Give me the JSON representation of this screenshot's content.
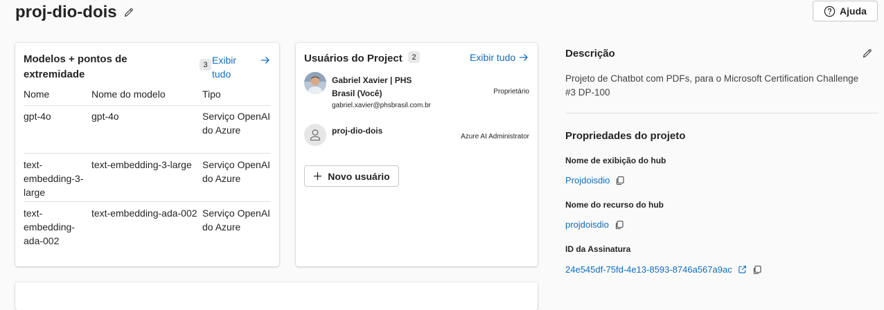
{
  "header": {
    "project_title": "proj-dio-dois",
    "help_label": "Ajuda"
  },
  "models_card": {
    "title_line1": "Modelos + pontos de",
    "title_line2": "extremidade",
    "count": "3",
    "view_all_line1": "Exibir",
    "view_all_line2": "tudo",
    "columns": [
      "Nome",
      "Nome do modelo",
      "Tipo"
    ],
    "rows": [
      {
        "name_lines": [
          "gpt-4o"
        ],
        "model": "gpt-4o",
        "type_lines": [
          "Serviço OpenAI",
          "do Azure"
        ]
      },
      {
        "name_lines": [
          "text-",
          "embedding-3-",
          "large"
        ],
        "model": "text-embedding-3-large",
        "type_lines": [
          "Serviço OpenAI",
          "do Azure"
        ]
      },
      {
        "name_lines": [
          "text-",
          "embedding-",
          "ada-002"
        ],
        "model": "text-embedding-ada-002",
        "type_lines": [
          "Serviço OpenAI",
          "do Azure"
        ]
      }
    ]
  },
  "users_card": {
    "title": "Usuários do Project",
    "count": "2",
    "view_all": "Exibir tudo",
    "users": [
      {
        "name_line1": "Gabriel Xavier | PHS",
        "name_line2": "Brasil (Você)",
        "email": "gabriel.xavier@phsbrasil.com.br",
        "role": "Proprietário"
      },
      {
        "name_line1": "proj-dio-dois",
        "role": "Azure AI Administrator"
      }
    ],
    "new_user_label": "Novo usuário"
  },
  "description": {
    "heading": "Descrição",
    "text_line1": "Projeto de Chatbot com PDFs, para o Microsoft Certification Challenge",
    "text_line2": "#3 DP-100"
  },
  "properties": {
    "heading": "Propriedades do projeto",
    "hub_display_label": "Nome de exibição do hub",
    "hub_display_value": "Projdoisdio",
    "hub_resource_label": "Nome do recurso do hub",
    "hub_resource_value": "projdoisdio",
    "subscription_label": "ID da Assinatura",
    "subscription_value": "24e545df-75fd-4e13-8593-8746a567a9ac"
  },
  "colors": {
    "link": "#0f6cbd",
    "text": "#242424",
    "background": "#fafafa"
  }
}
